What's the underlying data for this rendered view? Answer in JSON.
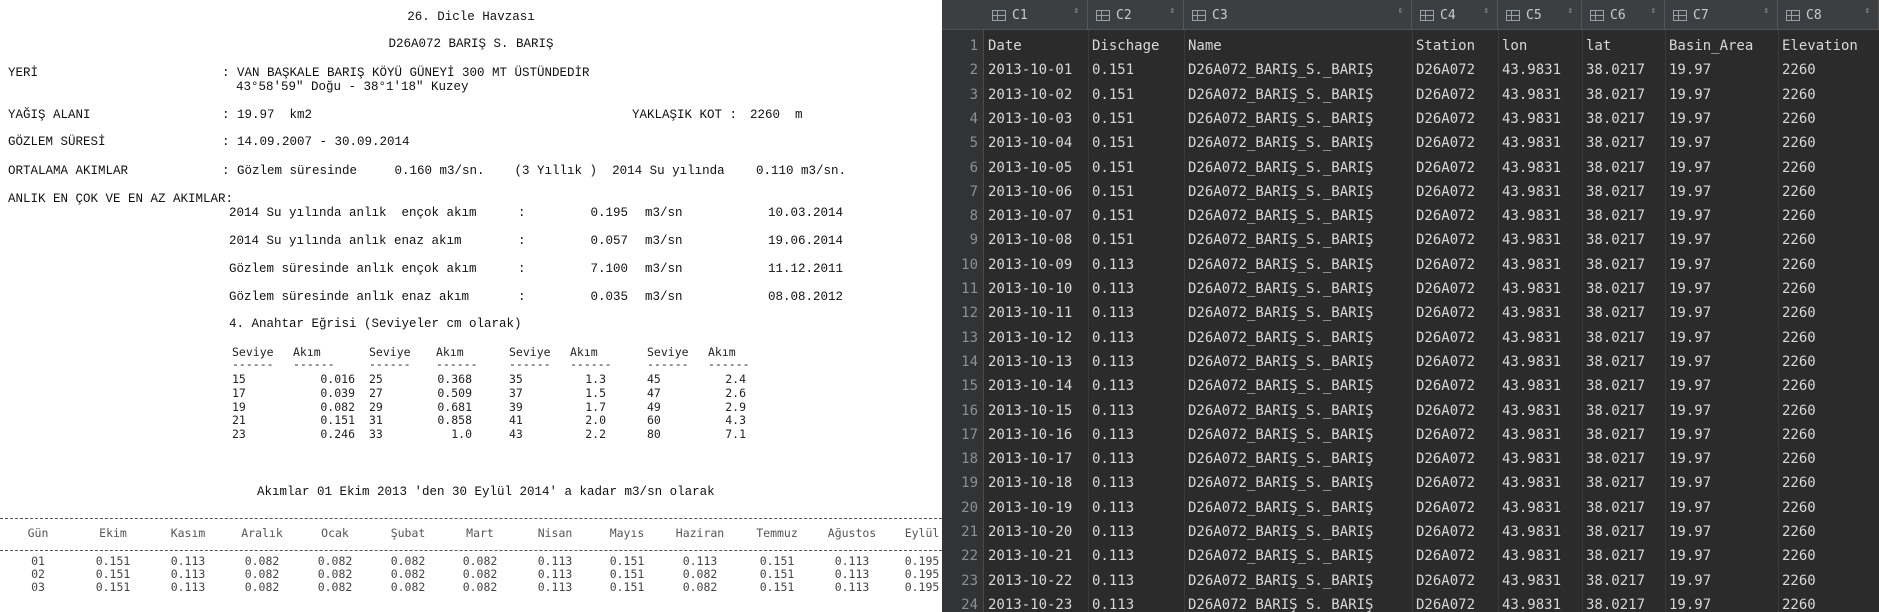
{
  "doc": {
    "basin": "26. Dicle Havzası",
    "station_title": "D26A072 BARIŞ S. BARIŞ",
    "location_label": "YERİ",
    "location_line1": ": VAN BAŞKALE BARIŞ KÖYÜ GÜNEYİ 300 MT ÜSTÜNDEDİR",
    "location_line2": "43°58'59\" Doğu - 38°1'18\" Kuzey",
    "area_label": "YAĞIŞ ALANI",
    "area_value": ": 19.97  km2",
    "elev_label": "YAKLAŞIK KOT :",
    "elev_value": "2260  m",
    "period_label": "GÖZLEM SÜRESİ",
    "period_value": ": 14.09.2007 - 30.09.2014",
    "avg_label": "ORTALAMA AKIMLAR",
    "avg_text": ": Gözlem süresinde     0.160 m3/sn.    (3 Yıllık )  2014 Su yılında",
    "avg_value2": "0.110 m3/sn.",
    "extremes_label": "ANLIK EN ÇOK VE EN AZ AKIMLAR:",
    "extremes": [
      {
        "label": "2014 Su yılında anlık  ençok akım",
        "sep": ":",
        "value": "0.195",
        "unit": "m3/sn",
        "date": "10.03.2014"
      },
      {
        "label": "2014 Su yılında anlık enaz akım",
        "sep": ":",
        "value": "0.057",
        "unit": "m3/sn",
        "date": "19.06.2014"
      },
      {
        "label": "Gözlem süresinde anlık ençok akım",
        "sep": ":",
        "value": "7.100",
        "unit": "m3/sn",
        "date": "11.12.2011"
      },
      {
        "label": "Gözlem süresinde anlık enaz akım",
        "sep": ":",
        "value": "0.035",
        "unit": "m3/sn",
        "date": "08.08.2012"
      }
    ],
    "rating_title": "4. Anahtar Eğrisi (Seviyeler cm olarak)",
    "rating_headers": [
      "Seviye",
      "Akım",
      "Seviye",
      "Akım",
      "Seviye",
      "Akım",
      "Seviye",
      "Akım"
    ],
    "rating_dashes": "------",
    "rating_rows": [
      [
        "15",
        "0.016",
        "25",
        "0.368",
        "35",
        "1.3",
        "45",
        "2.4"
      ],
      [
        "17",
        "0.039",
        "27",
        "0.509",
        "37",
        "1.5",
        "47",
        "2.6"
      ],
      [
        "19",
        "0.082",
        "29",
        "0.681",
        "39",
        "1.7",
        "49",
        "2.9"
      ],
      [
        "21",
        "0.151",
        "31",
        "0.858",
        "41",
        "2.0",
        "60",
        "4.3"
      ],
      [
        "23",
        "0.246",
        "33",
        "1.0",
        "43",
        "2.2",
        "80",
        "7.1"
      ]
    ],
    "flows_title": "Akımlar 01 Ekim 2013 'den 30 Eylül 2014' a kadar m3/sn olarak",
    "flows_headers": [
      "Gün",
      "Ekim",
      "Kasım",
      "Aralık",
      "Ocak",
      "Şubat",
      "Mart",
      "Nisan",
      "Mayıs",
      "Haziran",
      "Temmuz",
      "Ağustos",
      "Eylül"
    ],
    "flows_rows": [
      [
        "01",
        "0.151",
        "0.113",
        "0.082",
        "0.082",
        "0.082",
        "0.082",
        "0.113",
        "0.151",
        "0.113",
        "0.151",
        "0.113",
        "0.195"
      ],
      [
        "02",
        "0.151",
        "0.113",
        "0.082",
        "0.082",
        "0.082",
        "0.082",
        "0.113",
        "0.151",
        "0.082",
        "0.151",
        "0.113",
        "0.195"
      ],
      [
        "03",
        "0.151",
        "0.113",
        "0.082",
        "0.082",
        "0.082",
        "0.082",
        "0.113",
        "0.151",
        "0.082",
        "0.151",
        "0.113",
        "0.195"
      ]
    ]
  },
  "grid": {
    "columns": [
      {
        "header": "C1",
        "icon": "table-icon"
      },
      {
        "header": "C2",
        "icon": "table-icon"
      },
      {
        "header": "C3",
        "icon": "table-icon"
      },
      {
        "header": "C4",
        "icon": "table-icon"
      },
      {
        "header": "C5",
        "icon": "table-icon"
      },
      {
        "header": "C6",
        "icon": "table-icon"
      },
      {
        "header": "C7",
        "icon": "table-icon"
      },
      {
        "header": "C8",
        "icon": "table-icon"
      }
    ],
    "sort_glyph": "⇕",
    "rows": [
      [
        "Date",
        "Dischage",
        "Name",
        "Station",
        "lon",
        "lat",
        "Basin_Area",
        "Elevation"
      ],
      [
        "2013-10-01",
        "0.151",
        "D26A072_BARIŞ_S._BARIŞ",
        "D26A072",
        "43.9831",
        "38.0217",
        "19.97",
        "2260"
      ],
      [
        "2013-10-02",
        "0.151",
        "D26A072_BARIŞ_S._BARIŞ",
        "D26A072",
        "43.9831",
        "38.0217",
        "19.97",
        "2260"
      ],
      [
        "2013-10-03",
        "0.151",
        "D26A072_BARIŞ_S._BARIŞ",
        "D26A072",
        "43.9831",
        "38.0217",
        "19.97",
        "2260"
      ],
      [
        "2013-10-04",
        "0.151",
        "D26A072_BARIŞ_S._BARIŞ",
        "D26A072",
        "43.9831",
        "38.0217",
        "19.97",
        "2260"
      ],
      [
        "2013-10-05",
        "0.151",
        "D26A072_BARIŞ_S._BARIŞ",
        "D26A072",
        "43.9831",
        "38.0217",
        "19.97",
        "2260"
      ],
      [
        "2013-10-06",
        "0.151",
        "D26A072_BARIŞ_S._BARIŞ",
        "D26A072",
        "43.9831",
        "38.0217",
        "19.97",
        "2260"
      ],
      [
        "2013-10-07",
        "0.151",
        "D26A072_BARIŞ_S._BARIŞ",
        "D26A072",
        "43.9831",
        "38.0217",
        "19.97",
        "2260"
      ],
      [
        "2013-10-08",
        "0.151",
        "D26A072_BARIŞ_S._BARIŞ",
        "D26A072",
        "43.9831",
        "38.0217",
        "19.97",
        "2260"
      ],
      [
        "2013-10-09",
        "0.113",
        "D26A072_BARIŞ_S._BARIŞ",
        "D26A072",
        "43.9831",
        "38.0217",
        "19.97",
        "2260"
      ],
      [
        "2013-10-10",
        "0.113",
        "D26A072_BARIŞ_S._BARIŞ",
        "D26A072",
        "43.9831",
        "38.0217",
        "19.97",
        "2260"
      ],
      [
        "2013-10-11",
        "0.113",
        "D26A072_BARIŞ_S._BARIŞ",
        "D26A072",
        "43.9831",
        "38.0217",
        "19.97",
        "2260"
      ],
      [
        "2013-10-12",
        "0.113",
        "D26A072_BARIŞ_S._BARIŞ",
        "D26A072",
        "43.9831",
        "38.0217",
        "19.97",
        "2260"
      ],
      [
        "2013-10-13",
        "0.113",
        "D26A072_BARIŞ_S._BARIŞ",
        "D26A072",
        "43.9831",
        "38.0217",
        "19.97",
        "2260"
      ],
      [
        "2013-10-14",
        "0.113",
        "D26A072_BARIŞ_S._BARIŞ",
        "D26A072",
        "43.9831",
        "38.0217",
        "19.97",
        "2260"
      ],
      [
        "2013-10-15",
        "0.113",
        "D26A072_BARIŞ_S._BARIŞ",
        "D26A072",
        "43.9831",
        "38.0217",
        "19.97",
        "2260"
      ],
      [
        "2013-10-16",
        "0.113",
        "D26A072_BARIŞ_S._BARIŞ",
        "D26A072",
        "43.9831",
        "38.0217",
        "19.97",
        "2260"
      ],
      [
        "2013-10-17",
        "0.113",
        "D26A072_BARIŞ_S._BARIŞ",
        "D26A072",
        "43.9831",
        "38.0217",
        "19.97",
        "2260"
      ],
      [
        "2013-10-18",
        "0.113",
        "D26A072_BARIŞ_S._BARIŞ",
        "D26A072",
        "43.9831",
        "38.0217",
        "19.97",
        "2260"
      ],
      [
        "2013-10-19",
        "0.113",
        "D26A072_BARIŞ_S._BARIŞ",
        "D26A072",
        "43.9831",
        "38.0217",
        "19.97",
        "2260"
      ],
      [
        "2013-10-20",
        "0.113",
        "D26A072_BARIŞ_S._BARIŞ",
        "D26A072",
        "43.9831",
        "38.0217",
        "19.97",
        "2260"
      ],
      [
        "2013-10-21",
        "0.113",
        "D26A072_BARIŞ_S._BARIŞ",
        "D26A072",
        "43.9831",
        "38.0217",
        "19.97",
        "2260"
      ],
      [
        "2013-10-22",
        "0.113",
        "D26A072_BARIŞ_S._BARIŞ",
        "D26A072",
        "43.9831",
        "38.0217",
        "19.97",
        "2260"
      ],
      [
        "2013-10-23",
        "0.113",
        "D26A072_BARIŞ_S._BARIŞ",
        "D26A072",
        "43.9831",
        "38.0217",
        "19.97",
        "2260"
      ]
    ]
  }
}
